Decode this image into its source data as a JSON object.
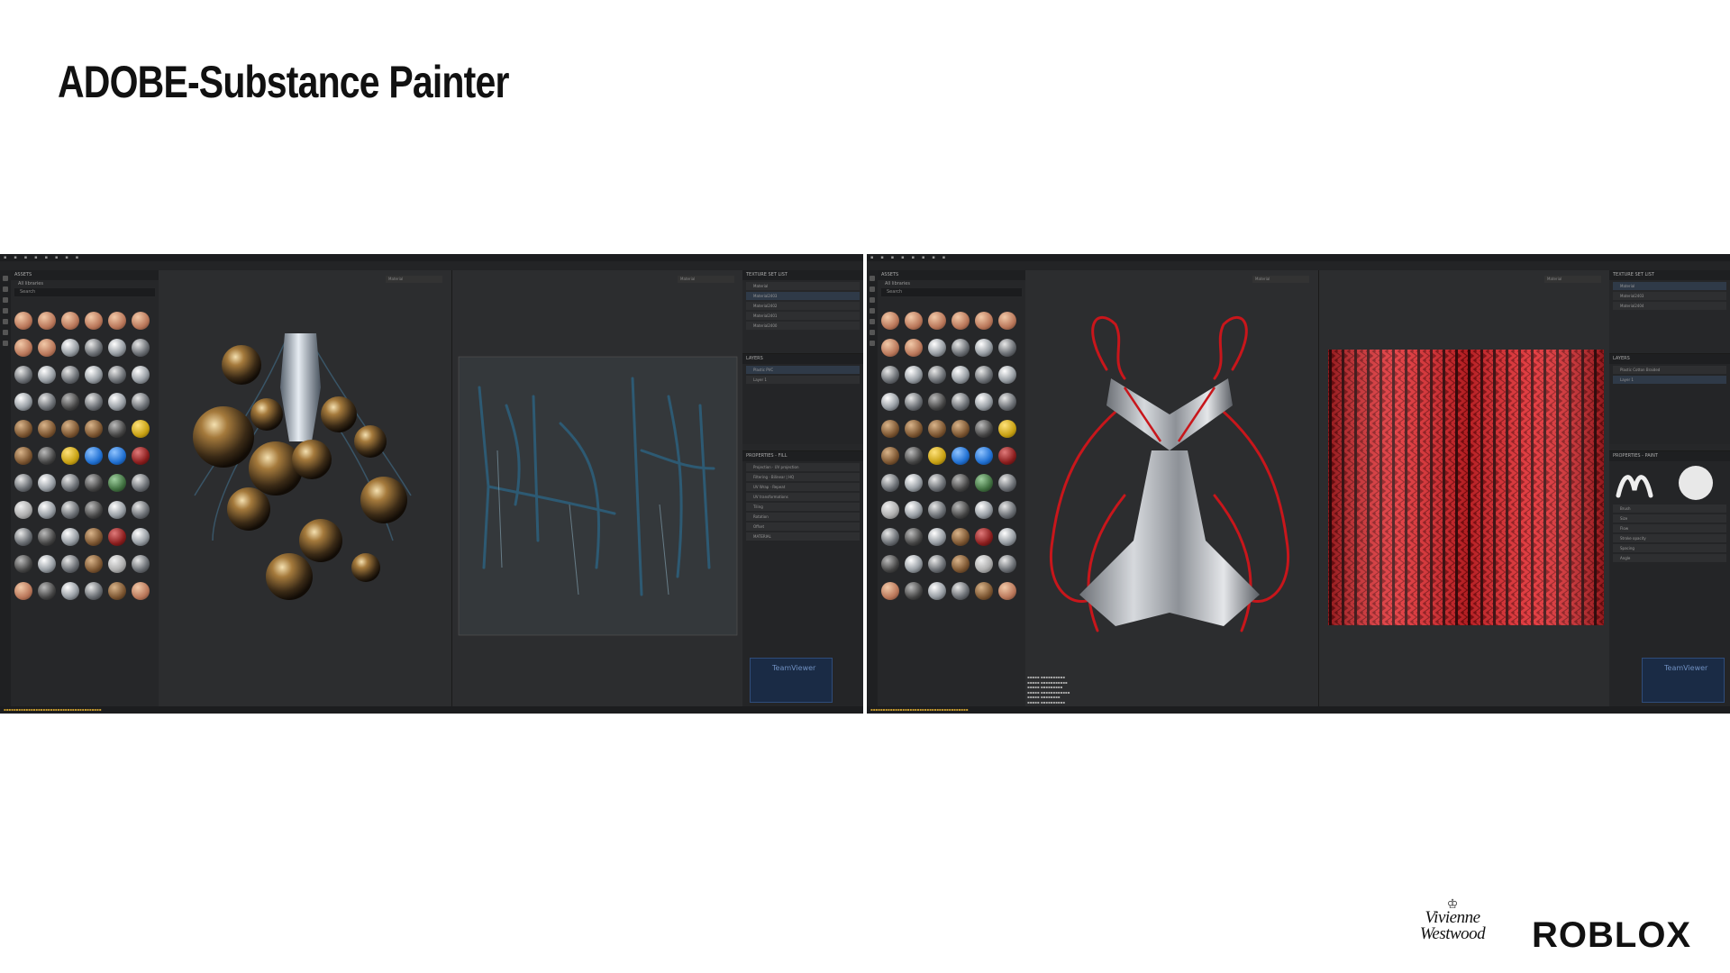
{
  "slide": {
    "title": "ADOBE-Substance Painter"
  },
  "left_screenshot": {
    "assets_panel_label": "ASSETS",
    "assets_filter": "All libraries",
    "assets_search_placeholder": "Search",
    "viewport_3d_mode": "Material",
    "viewport_2d_mode": "Material",
    "texture_set_list_label": "TEXTURE SET LIST",
    "texture_set_settings_label": "Settings",
    "texture_sets": [
      "Material",
      "Material2403",
      "Material2402",
      "Material2401",
      "Material2400"
    ],
    "layers_tab": "LAYERS",
    "texture_set_settings_tab": "TEXTURE SET SETTINGS",
    "layers": [
      "Plastic PVC",
      "Layer 1"
    ],
    "properties_label": "PROPERTIES - FILL",
    "fill_label": "FILL",
    "projection_label": "Projection",
    "projection_value": "UV projection",
    "filtering_label": "Filtering",
    "filtering_value": "Bilinear | HQ",
    "uv_wrap_label": "UV Wrap",
    "uv_wrap_value": "Repeat",
    "uv_transformations_label": "UV transformations",
    "tiling_label": "Tiling",
    "rotation_label": "Rotation",
    "offset_label": "Offset",
    "material_label": "MATERIAL",
    "material_channels": [
      "color",
      "metal",
      "rough",
      "nrm",
      "height"
    ],
    "material_mode_label": "Material mode",
    "material_mode_value": "No Resource Selected",
    "base_color_label": "Base color",
    "teamviewer_label": "TeamViewer"
  },
  "right_screenshot": {
    "assets_panel_label": "ASSETS",
    "assets_filter": "All libraries",
    "assets_search_placeholder": "Search",
    "viewport_3d_mode": "Material",
    "viewport_2d_mode": "Material",
    "texture_set_list_label": "TEXTURE SET LIST",
    "texture_set_settings_label": "Settings",
    "texture_sets": [
      "Material",
      "Material2403",
      "Material2404"
    ],
    "layers_tab": "LAYERS",
    "texture_set_settings_tab": "TEXTURE SET SETTINGS",
    "layers": [
      "Plastic Cotton Braided",
      "Layer 1"
    ],
    "properties_label": "PROPERTIES - PAINT",
    "brush_label": "Brush",
    "size_label": "Size",
    "flow_label": "Flow",
    "stroke_opacity_label": "Stroke opacity",
    "spacing_label": "Spacing",
    "angle_label": "Angle",
    "teamviewer_label": "TeamViewer"
  },
  "brands": {
    "fashion": "Vivienne Westwood",
    "fashion_line1": "Vivienne",
    "fashion_line2": "Westwood",
    "platform": "ROBLOX"
  },
  "colors": {
    "slide_bg": "#ffffff",
    "app_bg": "#2a2b2d",
    "panel_bg": "#262729",
    "status_warning": "#c79a2b",
    "accent_red": "#c8161b"
  }
}
